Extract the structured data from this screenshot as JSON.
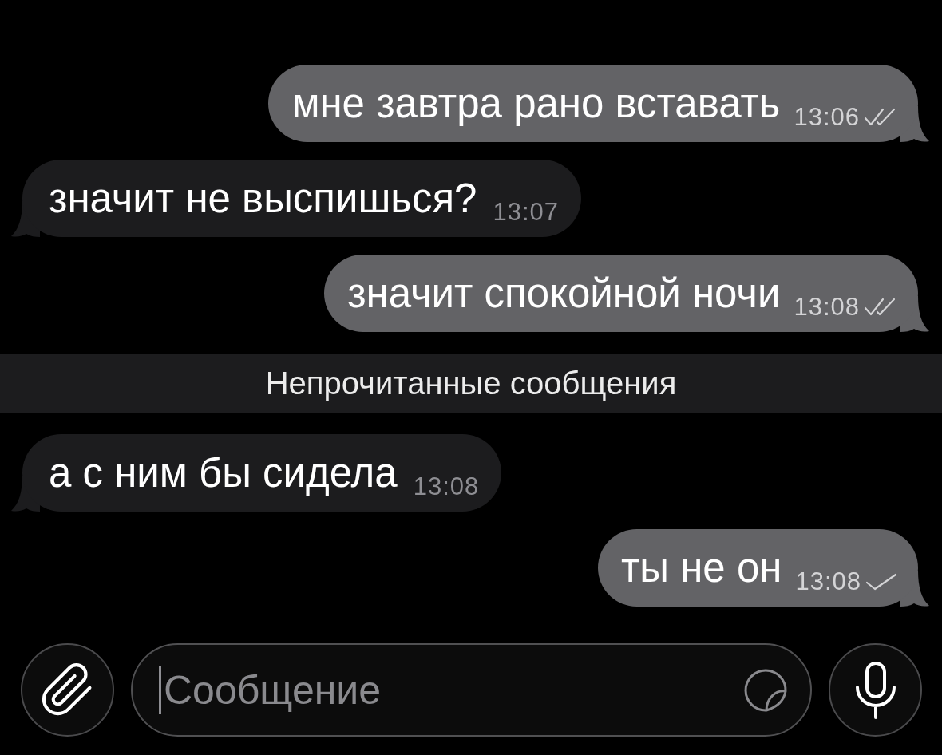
{
  "messages": [
    {
      "kind": "outgoing",
      "text": "мне завтра рано вставать",
      "time": "13:06",
      "read": true
    },
    {
      "kind": "incoming",
      "text": "значит не выспишься?",
      "time": "13:07"
    },
    {
      "kind": "outgoing",
      "text": "значит спокойной ночи",
      "time": "13:08",
      "read": true
    },
    {
      "kind": "divider",
      "text": "Непрочитанные сообщения"
    },
    {
      "kind": "incoming",
      "text": "а с ним бы сидела",
      "time": "13:08"
    },
    {
      "kind": "outgoing",
      "text": "ты не он",
      "time": "13:08",
      "read": false
    }
  ],
  "composer": {
    "placeholder": "Сообщение"
  }
}
